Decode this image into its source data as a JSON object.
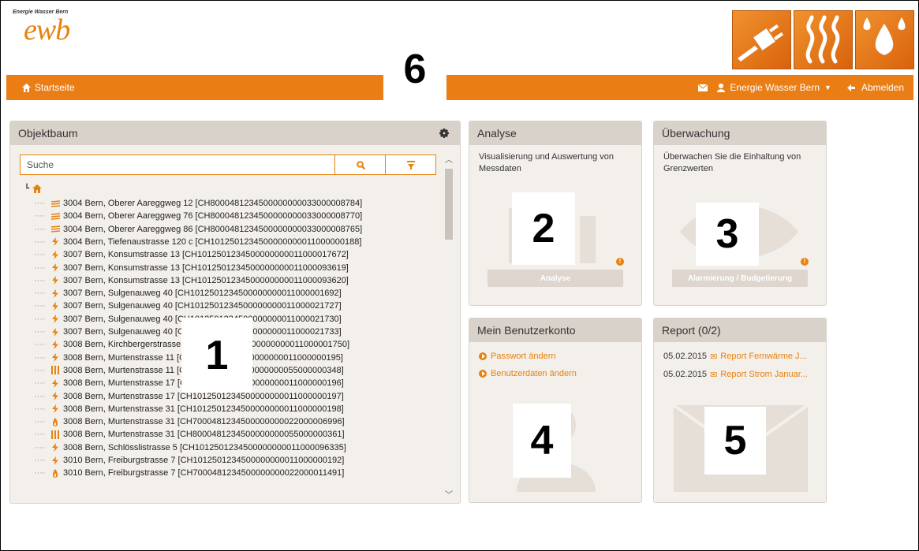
{
  "logo": {
    "small_text": "Energie Wasser Bern",
    "brand": "ewb"
  },
  "navbar": {
    "home": "Startseite",
    "user": "Energie Wasser Bern",
    "logout": "Abmelden"
  },
  "annotations": [
    "1",
    "2",
    "3",
    "4",
    "5",
    "6"
  ],
  "objektbaum": {
    "title": "Objektbaum",
    "search_placeholder": "Suche",
    "items": [
      {
        "icon": "heat-icon",
        "text": "3004 Bern, Oberer Aareggweg 12 [CH8000481234500000000033000008784]"
      },
      {
        "icon": "heat-icon",
        "text": "3004 Bern, Oberer Aareggweg 76 [CH8000481234500000000033000008770]"
      },
      {
        "icon": "heat-icon",
        "text": "3004 Bern, Oberer Aareggweg 86 [CH8000481234500000000033000008765]"
      },
      {
        "icon": "power-icon",
        "text": "3004 Bern, Tiefenaustrasse 120 c [CH1012501234500000000011000000188]"
      },
      {
        "icon": "power-icon",
        "text": "3007 Bern, Konsumstrasse 13 [CH1012501234500000000011000017672]"
      },
      {
        "icon": "power-icon",
        "text": "3007 Bern, Konsumstrasse 13 [CH1012501234500000000011000093619]"
      },
      {
        "icon": "power-icon",
        "text": "3007 Bern, Konsumstrasse 13 [CH1012501234500000000011000093620]"
      },
      {
        "icon": "power-icon",
        "text": "3007 Bern, Sulgenauweg 40 [CH1012501234500000000011000001692]"
      },
      {
        "icon": "power-icon",
        "text": "3007 Bern, Sulgenauweg 40 [CH1012501234500000000011000021727]"
      },
      {
        "icon": "power-icon",
        "text": "3007 Bern, Sulgenauweg 40 [CH1012501234500000000011000021730]"
      },
      {
        "icon": "power-icon",
        "text": "3007 Bern, Sulgenauweg 40 [CH1012501234500000000011000021733]"
      },
      {
        "icon": "power-icon",
        "text": "3008 Bern, Kirchbergerstrasse [CH1012501234500000000011000001750]"
      },
      {
        "icon": "power-icon",
        "text": "3008 Bern, Murtenstrasse 11 [CH1012501234500000000011000000195]"
      },
      {
        "icon": "water-meter-icon",
        "text": "3008 Bern, Murtenstrasse 11 [CH8000481234500000000055000000348]"
      },
      {
        "icon": "power-icon",
        "text": "3008 Bern, Murtenstrasse 17 [CH1012501234500000000011000000196]"
      },
      {
        "icon": "power-icon",
        "text": "3008 Bern, Murtenstrasse 17 [CH1012501234500000000011000000197]"
      },
      {
        "icon": "power-icon",
        "text": "3008 Bern, Murtenstrasse 31 [CH1012501234500000000011000000198]"
      },
      {
        "icon": "gas-icon",
        "text": "3008 Bern, Murtenstrasse 31 [CH7000481234500000000022000006996]"
      },
      {
        "icon": "water-meter-icon",
        "text": "3008 Bern, Murtenstrasse 31 [CH8000481234500000000055000000361]"
      },
      {
        "icon": "power-icon",
        "text": "3008 Bern, Schlösslistrasse 5 [CH1012501234500000000011000096335]"
      },
      {
        "icon": "power-icon",
        "text": "3010 Bern, Freiburgstrasse 7 [CH1012501234500000000011000000192]"
      },
      {
        "icon": "gas-icon",
        "text": "3010 Bern, Freiburgstrasse 7 [CH7000481234500000000022000011491]"
      }
    ]
  },
  "analyse": {
    "title": "Analyse",
    "desc": "Visualisierung und Auswertung von Messdaten",
    "button": "Analyse"
  },
  "ueberwachung": {
    "title": "Überwachung",
    "desc": "Überwachen Sie die Einhaltung von Grenzwerten",
    "button": "Alarmierung / Budgetierung"
  },
  "konto": {
    "title": "Mein Benutzerkonto",
    "links": [
      "Passwort ändern",
      "Benutzerdaten ändern"
    ]
  },
  "report": {
    "title": "Report (0/2)",
    "rows": [
      {
        "date": "05.02.2015",
        "label": "Report Fernwärme J..."
      },
      {
        "date": "05.02.2015",
        "label": "Report Strom Januar..."
      }
    ]
  },
  "colors": {
    "accent": "#ea7e14",
    "panel": "#f3efea",
    "panel_head": "#d9d2cb"
  }
}
